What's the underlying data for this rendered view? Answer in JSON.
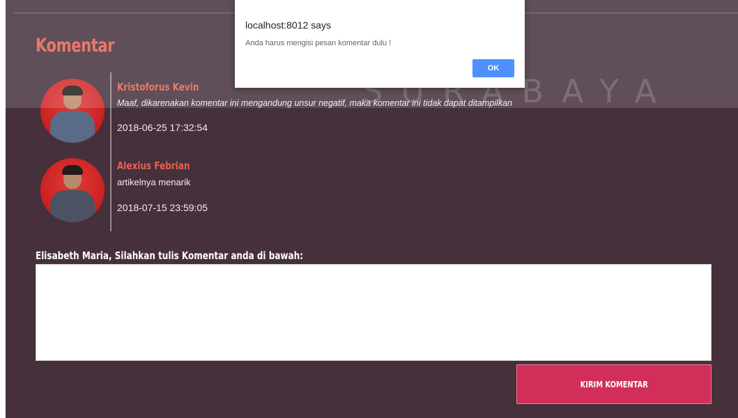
{
  "section": {
    "title": "Komentar"
  },
  "comments": [
    {
      "name": "Kristoforus Kevin",
      "text": "Maaf, dikarenakan komentar ini mengandung unsur negatif, maka komentar ini tidak dapat ditampilkan",
      "date": "2018-06-25 17:32:54"
    },
    {
      "name": "Alexius Febrian",
      "text": "artikelnya menarik",
      "date": "2018-07-15 23:59:05"
    }
  ],
  "form": {
    "prompt": "Elisabeth Maria, Silahkan tulis Komentar anda di bawah:",
    "comment_value": "",
    "submit_label": "KIRIM KOMENTAR"
  },
  "dialog": {
    "title": "localhost:8012 says",
    "message": "Anda harus mengisi pesan komentar dulu !",
    "ok_label": "OK"
  },
  "watermark": "SURABAYA",
  "colors": {
    "background": "#45303b",
    "accent_name": "#e8614f",
    "submit_button": "#d22e5a",
    "dialog_button": "#4d90fe"
  }
}
